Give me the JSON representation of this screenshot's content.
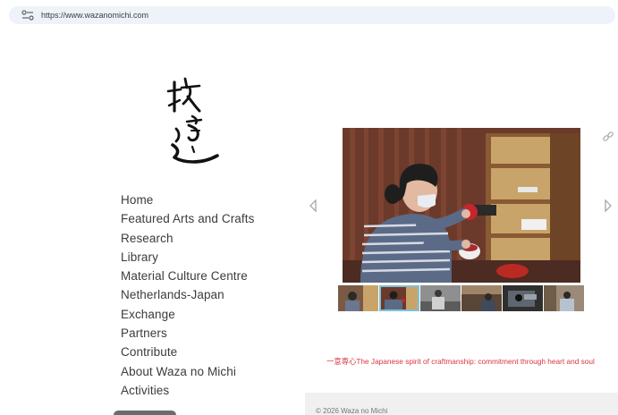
{
  "browser": {
    "url": "https://www.wazanomichi.com"
  },
  "nav": {
    "items": [
      "Home",
      "Featured Arts and Crafts",
      "Research",
      "Library",
      "Material Culture Centre",
      "Netherlands-Japan",
      "Exchange",
      "Partners",
      "Contribute",
      "About Waza no Michi",
      "Activities"
    ]
  },
  "slideshow": {
    "thumbnail_count": 6,
    "active_thumbnail": 2
  },
  "tagline": "一意専心The Japanese spirit of craftmanship: commitment through heart and soul",
  "footer": {
    "copyright": "© 2026 Waza no Michi"
  },
  "icons": {
    "site_info": "tune-icon",
    "prev": "chevron-left-icon",
    "next": "chevron-right-icon",
    "share": "link-icon"
  }
}
